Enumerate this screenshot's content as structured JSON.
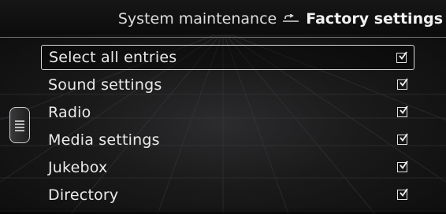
{
  "header": {
    "parent": "System maintenance",
    "separator_icon": "return-arrow-icon",
    "current": "Factory settings"
  },
  "items": [
    {
      "label": "Select all entries",
      "checked": true,
      "selected": true
    },
    {
      "label": "Sound settings",
      "checked": true,
      "selected": false
    },
    {
      "label": "Radio",
      "checked": true,
      "selected": false
    },
    {
      "label": "Media settings",
      "checked": true,
      "selected": false
    },
    {
      "label": "Jukebox",
      "checked": true,
      "selected": false
    },
    {
      "label": "Directory",
      "checked": true,
      "selected": false
    }
  ],
  "side_tab": {
    "icon": "menu-lines-icon"
  },
  "colors": {
    "background": "#1a1a1b",
    "text": "#eaeaea",
    "accent_border": "#d8d8d8"
  }
}
